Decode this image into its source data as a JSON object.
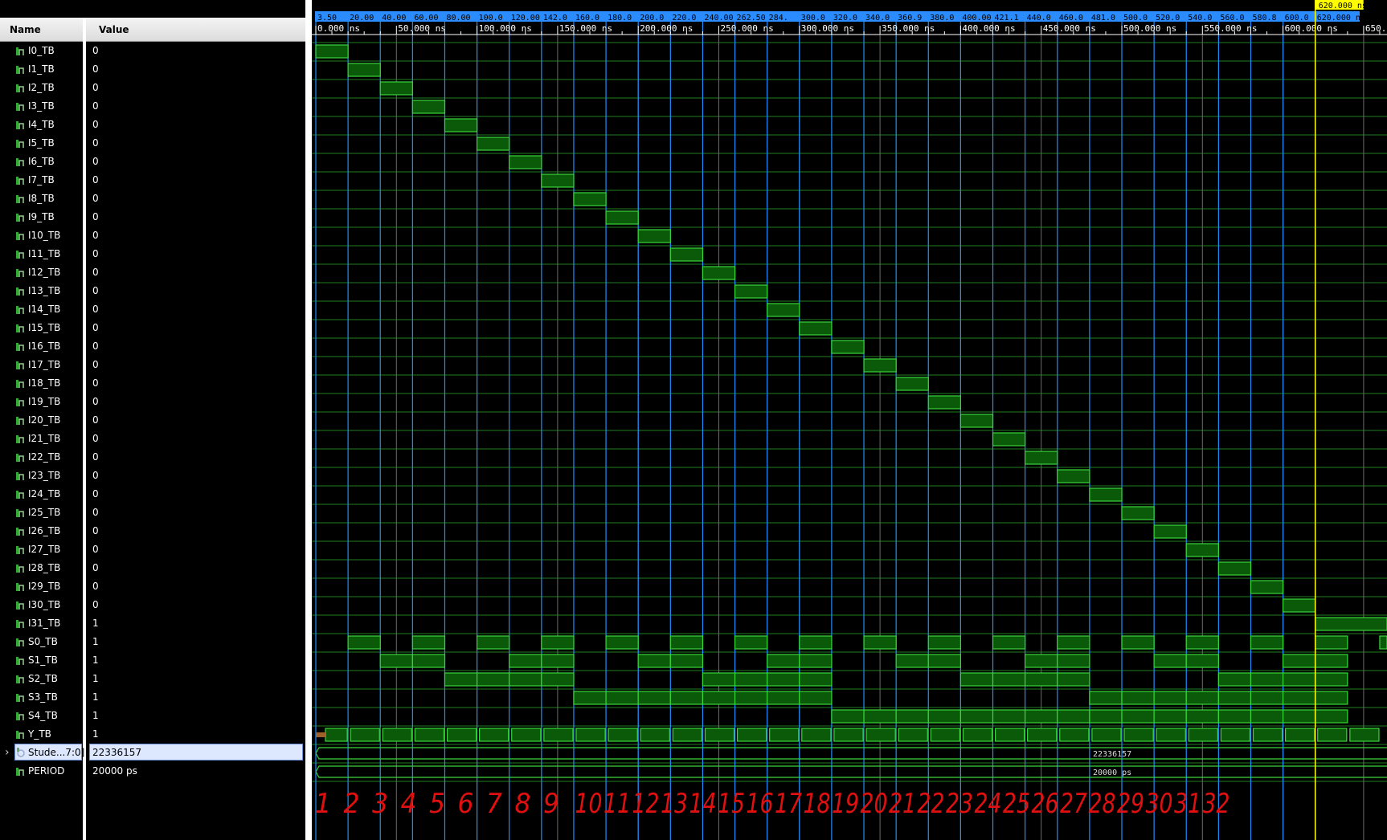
{
  "columns": {
    "name": "Name",
    "value": "Value"
  },
  "signals": [
    {
      "name": "I0_TB",
      "value": "0"
    },
    {
      "name": "I1_TB",
      "value": "0"
    },
    {
      "name": "I2_TB",
      "value": "0"
    },
    {
      "name": "I3_TB",
      "value": "0"
    },
    {
      "name": "I4_TB",
      "value": "0"
    },
    {
      "name": "I5_TB",
      "value": "0"
    },
    {
      "name": "I6_TB",
      "value": "0"
    },
    {
      "name": "I7_TB",
      "value": "0"
    },
    {
      "name": "I8_TB",
      "value": "0"
    },
    {
      "name": "I9_TB",
      "value": "0"
    },
    {
      "name": "I10_TB",
      "value": "0"
    },
    {
      "name": "I11_TB",
      "value": "0"
    },
    {
      "name": "I12_TB",
      "value": "0"
    },
    {
      "name": "I13_TB",
      "value": "0"
    },
    {
      "name": "I14_TB",
      "value": "0"
    },
    {
      "name": "I15_TB",
      "value": "0"
    },
    {
      "name": "I16_TB",
      "value": "0"
    },
    {
      "name": "I17_TB",
      "value": "0"
    },
    {
      "name": "I18_TB",
      "value": "0"
    },
    {
      "name": "I19_TB",
      "value": "0"
    },
    {
      "name": "I20_TB",
      "value": "0"
    },
    {
      "name": "I21_TB",
      "value": "0"
    },
    {
      "name": "I22_TB",
      "value": "0"
    },
    {
      "name": "I23_TB",
      "value": "0"
    },
    {
      "name": "I24_TB",
      "value": "0"
    },
    {
      "name": "I25_TB",
      "value": "0"
    },
    {
      "name": "I26_TB",
      "value": "0"
    },
    {
      "name": "I27_TB",
      "value": "0"
    },
    {
      "name": "I28_TB",
      "value": "0"
    },
    {
      "name": "I29_TB",
      "value": "0"
    },
    {
      "name": "I30_TB",
      "value": "0"
    },
    {
      "name": "I31_TB",
      "value": "1"
    },
    {
      "name": "S0_TB",
      "value": "1"
    },
    {
      "name": "S1_TB",
      "value": "1"
    },
    {
      "name": "S2_TB",
      "value": "1"
    },
    {
      "name": "S3_TB",
      "value": "1"
    },
    {
      "name": "S4_TB",
      "value": "1"
    },
    {
      "name": "Y_TB",
      "value": "1"
    },
    {
      "name": "Stude...7:0]",
      "value": "22336157",
      "bus": true
    },
    {
      "name": "PERIOD",
      "value": "20000 ps"
    }
  ],
  "cursor_time": "620.000 ns",
  "time_ticks": [
    "0.000 ns",
    "50.000 ns",
    "100.000 ns",
    "150.000 ns",
    "200.000 ns",
    "250.000 ns",
    "300.000 ns",
    "350.000 ns",
    "400.000 ns",
    "450.000 ns",
    "500.000 ns",
    "550.000 ns",
    "600.000 ns",
    "650.0"
  ],
  "markers": [
    "3.50",
    "20.00",
    "40.00",
    "60.00",
    "80.00",
    "100.0",
    "120.00",
    "142.0",
    "160.0",
    "180.0",
    "200.0",
    "220.0",
    "240.00",
    "262.50",
    "284.",
    "300.0",
    "320.0",
    "340.0",
    "360.9",
    "380.0",
    "400.00",
    "421.1",
    "440.0",
    "460.0",
    "481.0",
    "500.0",
    "520.0",
    "540.0",
    "560.0",
    "580.8",
    "600.0",
    "620.000 ns"
  ],
  "bus_wave_label": "22336157",
  "period_wave_label": "20000 ps",
  "annotations": [
    "1",
    "2",
    "3",
    "4",
    "5",
    "6",
    "7",
    "8",
    "9",
    "10",
    "11",
    "12",
    "13",
    "14",
    "15",
    "16",
    "17",
    "18",
    "19",
    "20",
    "21",
    "22",
    "23",
    "24",
    "25",
    "26",
    "27",
    "28",
    "29",
    "30",
    "31",
    "32"
  ],
  "colors": {
    "wave": "#3ad63a",
    "fill": "#0a5a0a",
    "marker": "#1e8fff",
    "cursor": "#ffff00",
    "annotation": "#e01010"
  }
}
